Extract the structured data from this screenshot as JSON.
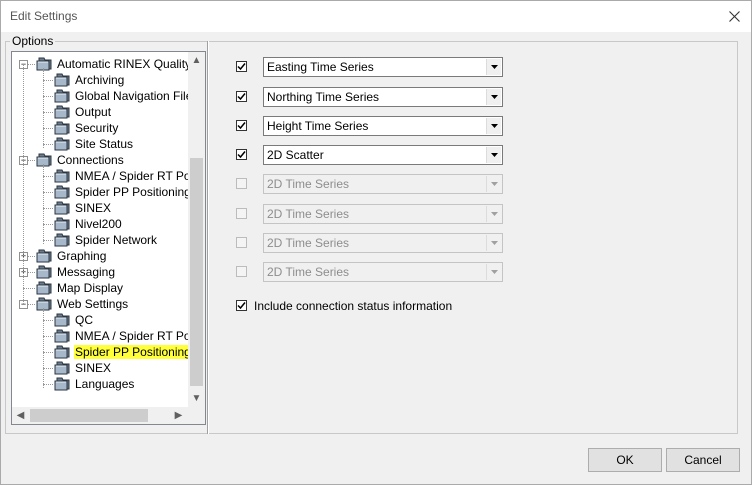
{
  "window": {
    "title": "Edit Settings"
  },
  "options_group": {
    "label": "Options"
  },
  "tree": {
    "nodes": [
      {
        "label": "Automatic RINEX Quality Ch",
        "expander": "-"
      },
      {
        "label": "Archiving"
      },
      {
        "label": "Global Navigation Files"
      },
      {
        "label": "Output"
      },
      {
        "label": "Security"
      },
      {
        "label": "Site Status"
      },
      {
        "label": "Connections",
        "expander": "-"
      },
      {
        "label": "NMEA / Spider RT Posi"
      },
      {
        "label": "Spider PP Positioning"
      },
      {
        "label": "SINEX"
      },
      {
        "label": "Nivel200"
      },
      {
        "label": "Spider Network"
      },
      {
        "label": "Graphing",
        "expander": "+"
      },
      {
        "label": "Messaging",
        "expander": "+"
      },
      {
        "label": "Map Display"
      },
      {
        "label": "Web Settings",
        "expander": "-"
      },
      {
        "label": "QC"
      },
      {
        "label": "NMEA / Spider RT Posi"
      },
      {
        "label": "Spider PP Positioning",
        "selected": true
      },
      {
        "label": "SINEX"
      },
      {
        "label": "Languages"
      }
    ],
    "expand_glyph": "+",
    "collapse_glyph": "−"
  },
  "graph_rows": [
    {
      "checked": true,
      "enabled": true,
      "value": "Easting Time Series"
    },
    {
      "checked": true,
      "enabled": true,
      "value": "Northing Time Series"
    },
    {
      "checked": true,
      "enabled": true,
      "value": "Height Time Series"
    },
    {
      "checked": true,
      "enabled": true,
      "value": "2D Scatter"
    },
    {
      "checked": false,
      "enabled": false,
      "value": "2D Time Series"
    },
    {
      "checked": false,
      "enabled": false,
      "value": "2D Time Series"
    },
    {
      "checked": false,
      "enabled": false,
      "value": "2D Time Series"
    },
    {
      "checked": false,
      "enabled": false,
      "value": "2D Time Series"
    }
  ],
  "include_status": {
    "checked": true,
    "label": "Include connection status information"
  },
  "buttons": {
    "ok": "OK",
    "cancel": "Cancel"
  },
  "colors": {
    "selection_highlight": "#ffff3a",
    "dialog_bg": "#f0f0f0"
  }
}
